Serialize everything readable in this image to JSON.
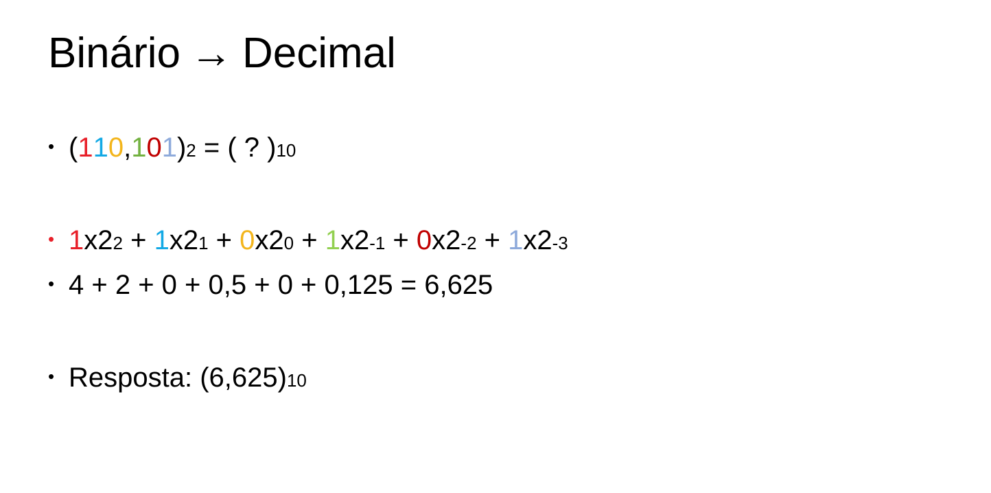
{
  "title": {
    "left": "Binário",
    "arrow": "→",
    "right": "Decimal"
  },
  "colors": {
    "red": "#e8202a",
    "cyan": "#13a9e5",
    "yellow": "#f3b51b",
    "green": "#72b140",
    "darkred": "#c00000",
    "lightblue": "#8eaadb",
    "lime": "#92d050",
    "bullet_red": "#e8202a"
  },
  "bullets": [
    {
      "open": "(",
      "digits": [
        "1",
        "1",
        "0",
        ",",
        "1",
        "0",
        "1"
      ],
      "close": ")",
      "base_from": "2",
      "equals": " = ( ? )",
      "base_to": "10"
    },
    {
      "terms": [
        {
          "digit": "1",
          "rest": "x2",
          "exp": "2",
          "sep": " + "
        },
        {
          "digit": "1",
          "rest": "x2",
          "exp": "1",
          "sep": " + "
        },
        {
          "digit": "0",
          "rest": "x2",
          "exp": "0",
          "sep": " + "
        },
        {
          "digit": "1",
          "rest": "x2",
          "exp": "-1",
          "sep": " + "
        },
        {
          "digit": "0",
          "rest": "x2",
          "exp": "-2",
          "sep": " + "
        },
        {
          "digit": "1",
          "rest": "x2",
          "exp": "-3",
          "sep": ""
        }
      ]
    },
    {
      "text": "4 + 2 + 0 + 0,5 + 0 + 0,125 = 6,625"
    },
    {
      "text": "Resposta: (6,625)",
      "base": "10"
    }
  ],
  "bullet_symbol": "•"
}
